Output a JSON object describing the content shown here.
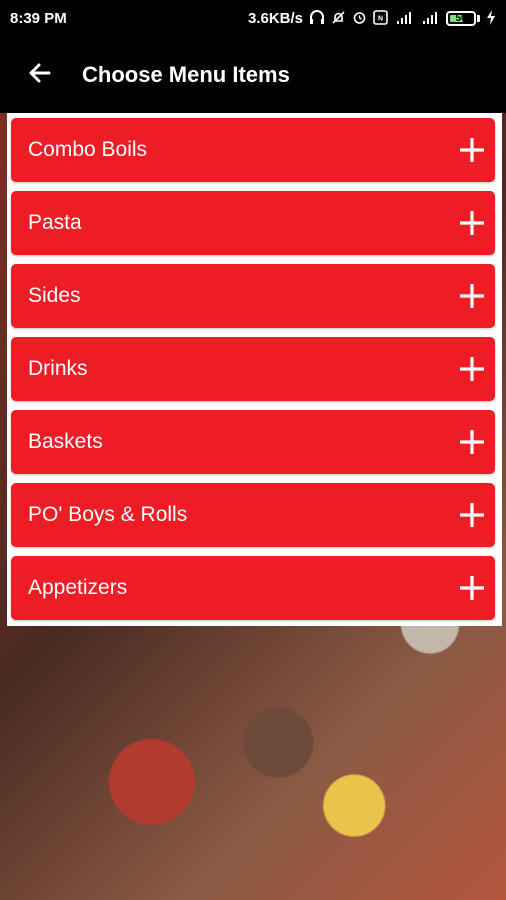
{
  "status_bar": {
    "time": "8:39 PM",
    "network_speed": "3.6KB/s",
    "battery_level": "50",
    "icons": [
      "headphones-icon",
      "mute-icon",
      "alarm-icon",
      "nfc-icon",
      "signal-4g-icon",
      "signal-icon",
      "battery-icon",
      "charging-icon"
    ]
  },
  "app_bar": {
    "title": "Choose Menu Items",
    "back_icon": "arrow-left-icon"
  },
  "menu": {
    "items": [
      {
        "label": "Combo Boils",
        "icon": "plus-icon"
      },
      {
        "label": "Pasta",
        "icon": "plus-icon"
      },
      {
        "label": "Sides",
        "icon": "plus-icon"
      },
      {
        "label": "Drinks",
        "icon": "plus-icon"
      },
      {
        "label": "Baskets",
        "icon": "plus-icon"
      },
      {
        "label": "PO' Boys & Rolls",
        "icon": "plus-icon"
      },
      {
        "label": "Appetizers",
        "icon": "plus-icon"
      }
    ]
  },
  "colors": {
    "accent_red": "#ee1d25",
    "bar_black": "#000000",
    "panel_white": "#ffffff"
  }
}
